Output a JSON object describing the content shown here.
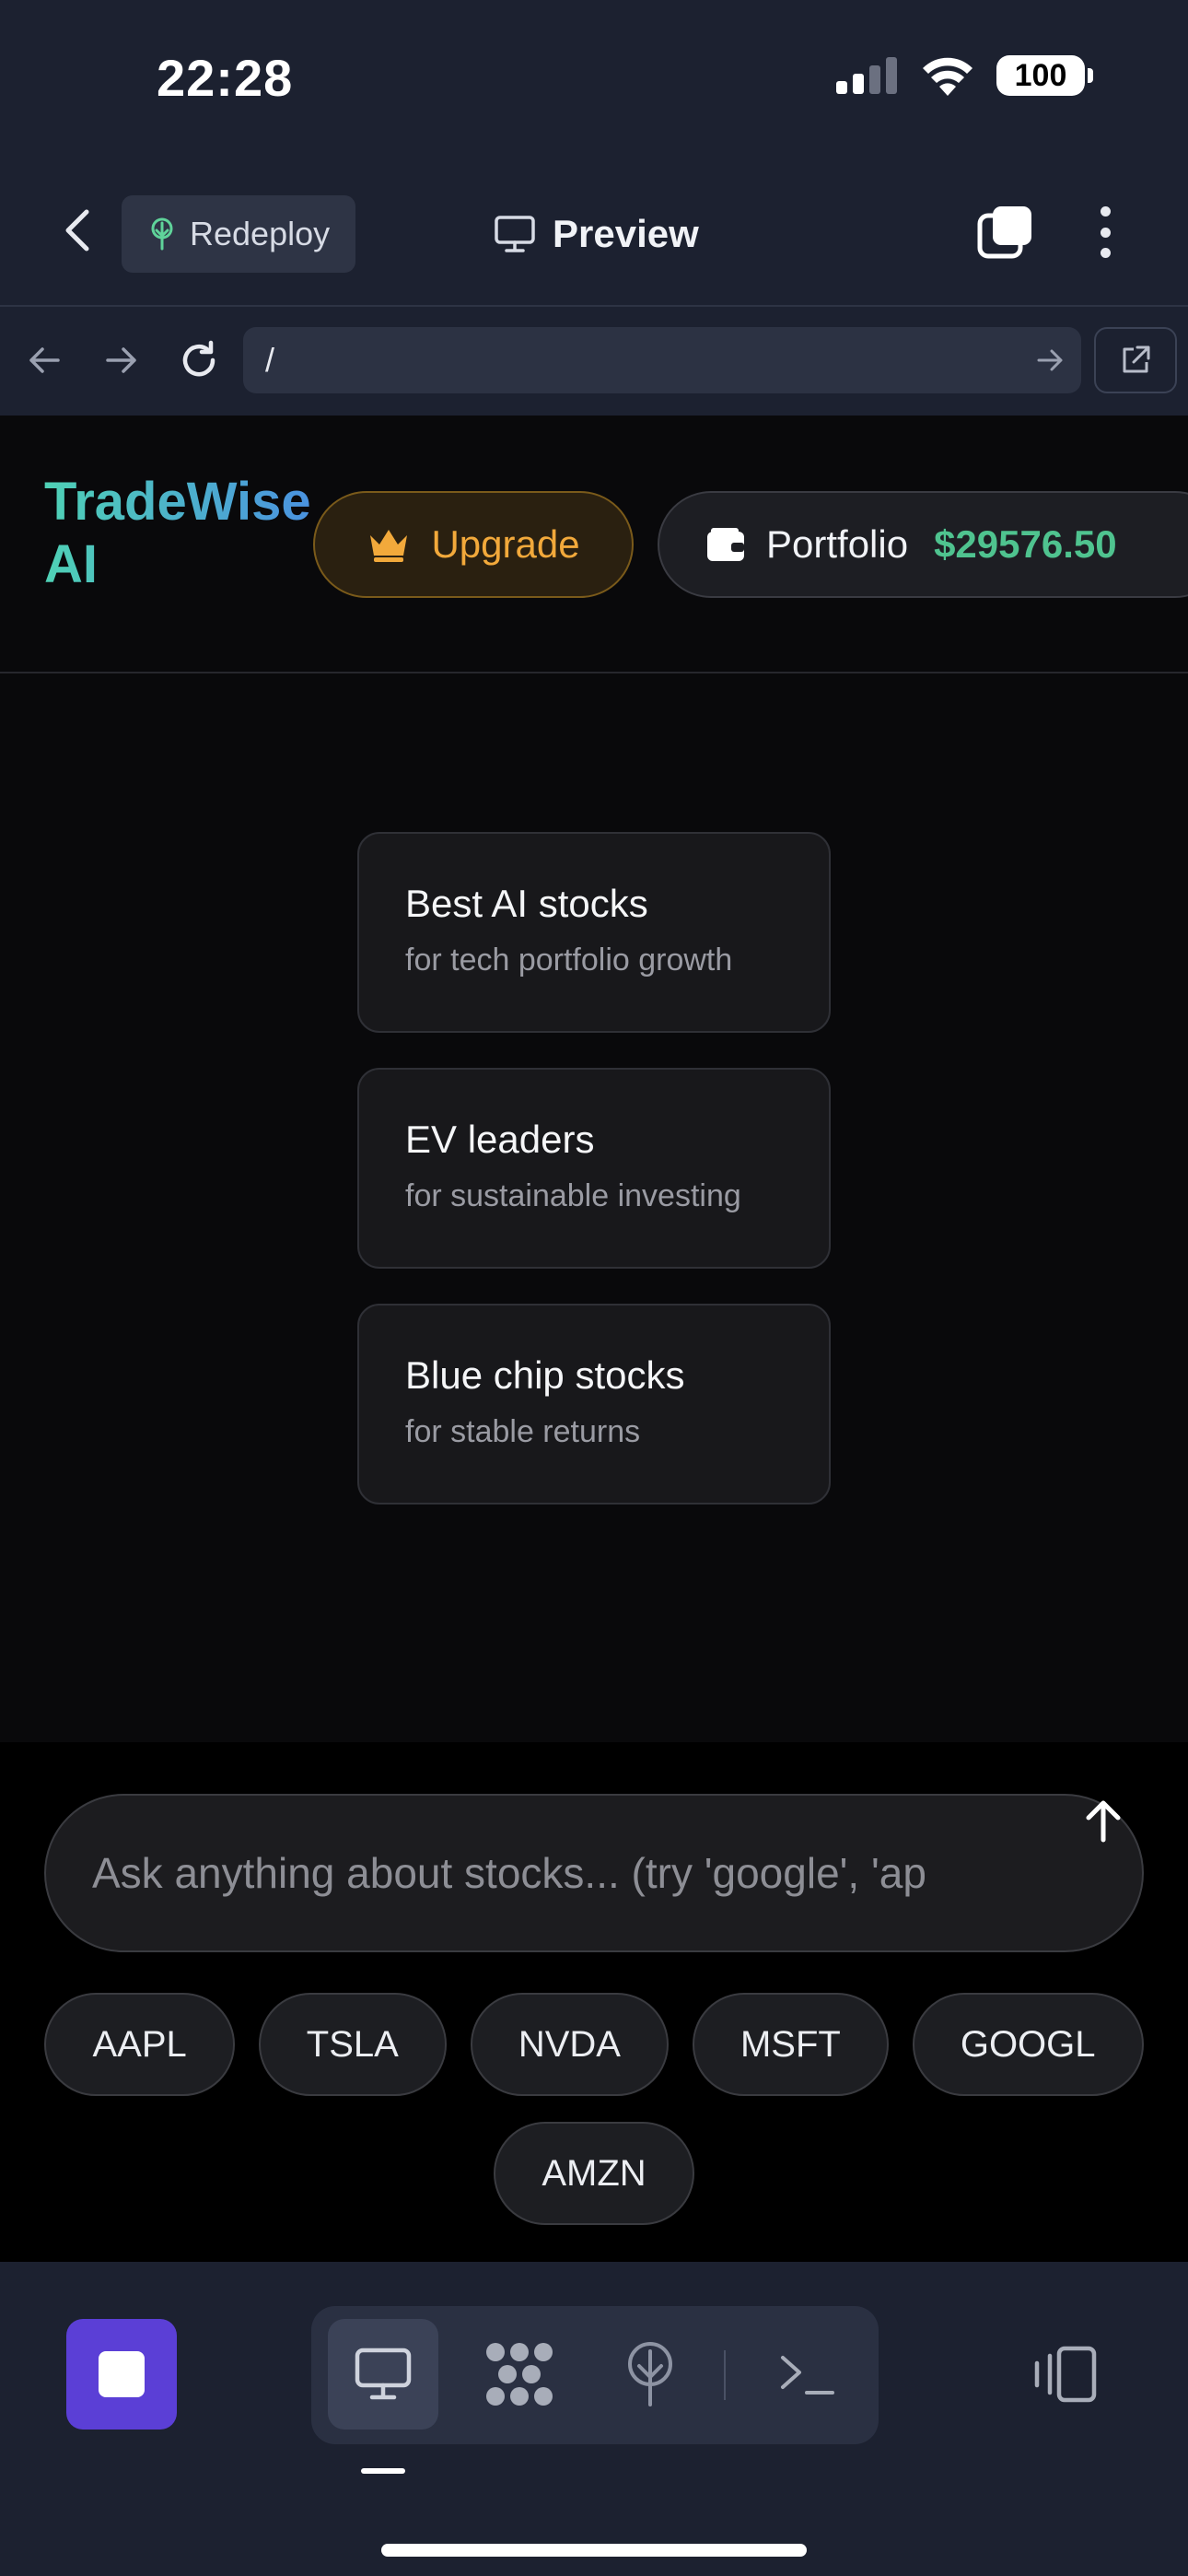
{
  "status_bar": {
    "time": "22:28",
    "battery": "100"
  },
  "app_bar": {
    "redeploy_label": "Redeploy",
    "title": "Preview"
  },
  "browser": {
    "url": "/"
  },
  "site": {
    "brand": "TradeWise AI",
    "upgrade_label": "Upgrade",
    "portfolio_label": "Portfolio",
    "portfolio_value": "$29576.50"
  },
  "suggestions": [
    {
      "title": "Best AI stocks",
      "subtitle": "for tech portfolio growth"
    },
    {
      "title": "EV leaders",
      "subtitle": "for sustainable investing"
    },
    {
      "title": "Blue chip stocks",
      "subtitle": "for stable returns"
    }
  ],
  "chat": {
    "placeholder": "Ask anything about stocks... (try 'google', 'ap",
    "tickers": [
      "AAPL",
      "TSLA",
      "NVDA",
      "MSFT",
      "GOOGL",
      "AMZN"
    ]
  },
  "colors": {
    "brand_gradient_start": "#4fd1b5",
    "brand_gradient_end": "#4a90e2",
    "upgrade_accent": "#f2a93b",
    "portfolio_value": "#4fc38f",
    "stop_button": "#5b3fd6"
  }
}
